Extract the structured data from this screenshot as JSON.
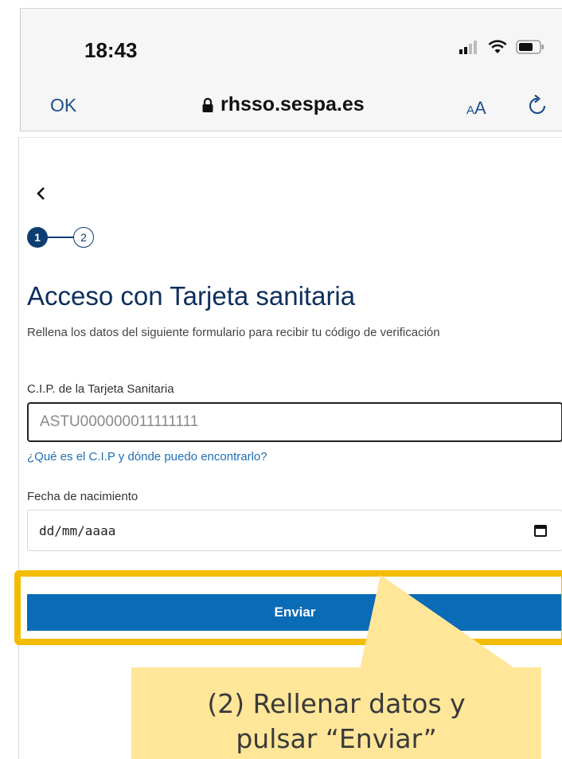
{
  "status_bar": {
    "time": "18:43",
    "icons": [
      "signal-icon",
      "wifi-icon",
      "battery-icon"
    ]
  },
  "browser_nav": {
    "done_label": "OK",
    "domain": "rhsso.sespa.es",
    "text_size_small": "A",
    "text_size_big": "A",
    "icons": [
      "lock-icon",
      "reload-icon"
    ]
  },
  "page": {
    "back_icon": "chevron-left-icon",
    "steps": [
      "1",
      "2"
    ],
    "active_step": 1,
    "title": "Acceso con Tarjeta sanitaria",
    "subtitle": "Rellena los datos del siguiente formulario para recibir tu código de verificación",
    "cip": {
      "label": "C.I.P. de la Tarjeta Sanitaria",
      "placeholder": "ASTU000000011111111",
      "help_link": "¿Qué es el C.I.P y dónde puedo encontrarlo?"
    },
    "dob": {
      "label": "Fecha de nacimiento",
      "value": "dd/mm/aaaa",
      "icon": "calendar-icon"
    },
    "submit_label": "Enviar"
  },
  "callout": {
    "line1": "(2) Rellenar datos y",
    "line2": "pulsar “Enviar”"
  },
  "colors": {
    "primary_button": "#0a6bb6",
    "title": "#0e2f5e",
    "link": "#1f6fb2",
    "highlight_border": "#f4bc00",
    "callout_bg": "#ffe699"
  }
}
